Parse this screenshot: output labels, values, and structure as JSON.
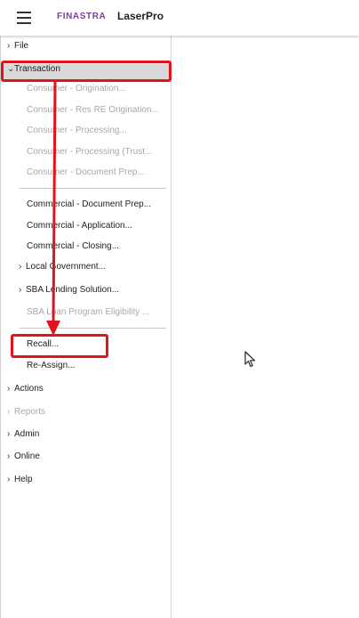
{
  "header": {
    "brand": "FINASTRA",
    "app_title": "LaserPro"
  },
  "menu": {
    "file": "File",
    "transaction": "Transaction",
    "transaction_items": [
      "Consumer - Origination...",
      "Consumer - Res RE Origination...",
      "Consumer - Processing...",
      "Consumer - Processing (Trust...",
      "Consumer - Document Prep...",
      "Commercial - Document Prep...",
      "Commercial - Application...",
      "Commercial - Closing...",
      "Local Government...",
      "SBA Lending Solution...",
      "SBA Loan Program Eligibility ...",
      "Recall...",
      "Re-Assign..."
    ],
    "actions": "Actions",
    "reports": "Reports",
    "admin": "Admin",
    "online": "Online",
    "help": "Help"
  },
  "colors": {
    "brand": "#7b3fa0",
    "highlight": "#e0151c",
    "disabled_text": "#a8a8a8",
    "active_row": "#d9d9d9"
  },
  "icons": {
    "menu": "hamburger-icon",
    "expand": "chevron-right-icon",
    "collapse": "chevron-down-icon",
    "pointer": "mouse-cursor-icon"
  }
}
